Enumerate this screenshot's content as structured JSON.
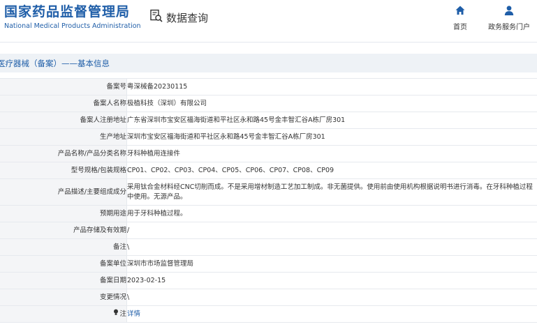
{
  "header": {
    "logo_cn": "国家药品监督管理局",
    "logo_en": "National Medical Products Administration",
    "query_label": "数据查询",
    "nav_home": "首页",
    "nav_portal": "政务服务门户"
  },
  "section": {
    "title": "医疗器械（备案）——基本信息"
  },
  "rows": [
    {
      "label": "备案号",
      "value": "粤深械备20230115"
    },
    {
      "label": "备案人名称",
      "value": "极植科技（深圳）有限公司"
    },
    {
      "label": "备案人注册地址",
      "value": "广东省深圳市宝安区福海街道和平社区永和路45号金丰智汇谷A栋厂房301"
    },
    {
      "label": "生产地址",
      "value": "深圳市宝安区福海街道和平社区永和路45号金丰智汇谷A栋厂房301"
    },
    {
      "label": "产品名称/产品分类名称",
      "value": "牙科种植用连接件"
    },
    {
      "label": "型号规格/包装规格",
      "value": "CP01、CP02、CP03、CP04、CP05、CP06、CP07、CP08、CP09"
    },
    {
      "label": "产品描述/主要组成成分",
      "value": "采用钛合金材料经CNC切削而成。不是采用增材制造工艺加工制成。非无菌提供。使用前由使用机构根据说明书进行消毒。在牙科种植过程中使用。无源产品。"
    },
    {
      "label": "预期用途",
      "value": "用于牙科种植过程。"
    },
    {
      "label": "产品存储及有效期",
      "value": "/"
    },
    {
      "label": "备注",
      "value": "\\"
    },
    {
      "label": "备案单位",
      "value": "深圳市市场监督管理局"
    },
    {
      "label": "备案日期",
      "value": "2023-02-15"
    },
    {
      "label": "变更情况",
      "value": "\\"
    },
    {
      "label": "注",
      "value": "详情"
    }
  ],
  "colors": {
    "brand": "#1f5ea8",
    "label_bg": "#f4f5f7",
    "section_bg": "#eef2f6"
  }
}
